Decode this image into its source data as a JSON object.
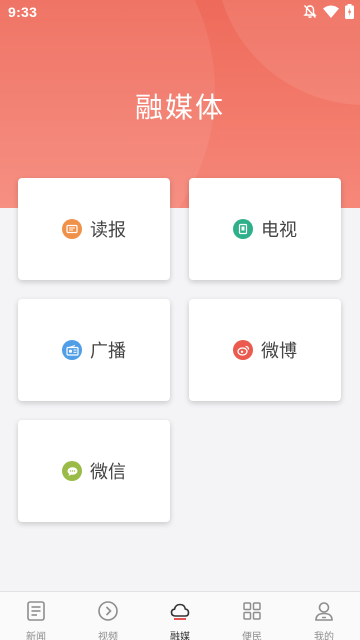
{
  "status_bar": {
    "time": "9:33"
  },
  "header": {
    "title": "融媒体"
  },
  "tiles": [
    {
      "label": "读报",
      "icon": "newspaper-icon",
      "color": "#f0914a"
    },
    {
      "label": "电视",
      "icon": "tv-icon",
      "color": "#2fb08b"
    },
    {
      "label": "广播",
      "icon": "radio-icon",
      "color": "#4f9ee6"
    },
    {
      "label": "微博",
      "icon": "weibo-icon",
      "color": "#ea5a4e"
    },
    {
      "label": "微信",
      "icon": "wechat-icon",
      "color": "#9bbb48"
    }
  ],
  "tabbar": {
    "active_color": "#333333",
    "items": [
      {
        "label": "新闻",
        "icon": "news-icon"
      },
      {
        "label": "视频",
        "icon": "video-icon"
      },
      {
        "label": "融媒",
        "icon": "cloud-icon",
        "active": true
      },
      {
        "label": "便民",
        "icon": "grid-icon"
      },
      {
        "label": "我的",
        "icon": "profile-icon"
      }
    ]
  },
  "colors": {
    "hero_top": "#ee6a5a",
    "hero_bottom": "#f6887a",
    "background": "#f4f4f6"
  }
}
